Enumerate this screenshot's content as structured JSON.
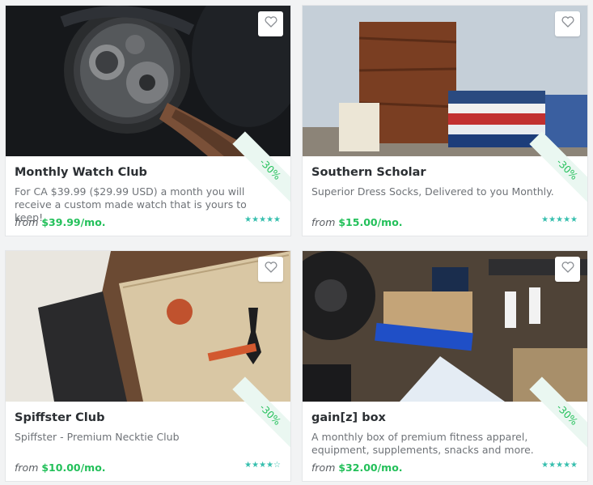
{
  "cards": [
    {
      "title": "Monthly Watch Club",
      "description": "For CA $39.99 ($29.99 USD) a month you will receive a custom made watch that is yours to keep!",
      "from_label": "from",
      "price": "$39.99",
      "period": "/mo.",
      "discount": "-30%",
      "rating": 5,
      "rating_stars": "★★★★★",
      "image": "watch-photo"
    },
    {
      "title": "Southern Scholar",
      "description": "Superior Dress Socks, Delivered to you Monthly.",
      "from_label": "from",
      "price": "$15.00",
      "period": "/mo.",
      "discount": "-30%",
      "rating": 5,
      "rating_stars": "★★★★★",
      "image": "socks-box-photo"
    },
    {
      "title": "Spiffster Club",
      "description": "Spiffster - Premium Necktie Club",
      "from_label": "from",
      "price": "$10.00",
      "period": "/mo.",
      "discount": "-30%",
      "rating": 4.5,
      "rating_stars": "★★★★☆",
      "image": "necktie-box-photo"
    },
    {
      "title": "gain[z] box",
      "description": "A monthly box of premium fitness apparel, equipment, supplements, snacks and more.",
      "from_label": "from",
      "price": "$32.00",
      "period": "/mo.",
      "discount": "-30%",
      "rating": 5,
      "rating_stars": "★★★★★",
      "image": "fitness-gear-photo"
    }
  ],
  "colors": {
    "price": "#23c05a",
    "stars": "#37bfae",
    "ribbon_bg": "#eaf7f1"
  }
}
